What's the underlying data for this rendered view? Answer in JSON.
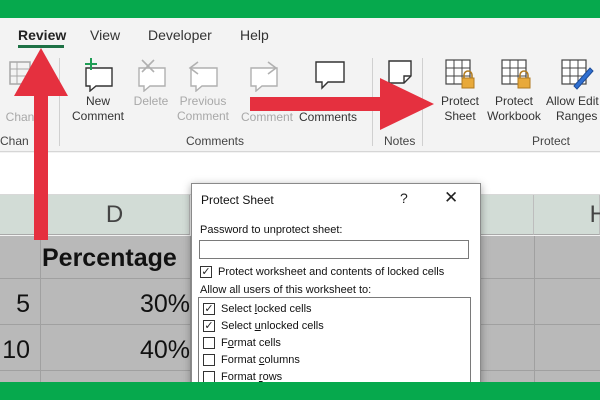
{
  "tabs": {
    "review": "Review",
    "view": "View",
    "developer": "Developer",
    "help": "Help"
  },
  "ribbon": {
    "changes_partial": "Chan",
    "changes_group_partial": "Chan",
    "new_comment": [
      "New",
      "Comment"
    ],
    "delete": "Delete",
    "previous_comment": [
      "Previous",
      "Comment"
    ],
    "next_comment_partial": "Comment",
    "show_comments": "Comments",
    "comments_group": "Comments",
    "notes_group": "Notes",
    "protect_sheet": [
      "Protect",
      "Sheet"
    ],
    "protect_workbook": [
      "Protect",
      "Workbook"
    ],
    "allow_edit_ranges": [
      "Allow Edit",
      "Ranges"
    ],
    "protect_group": "Protect"
  },
  "sheet": {
    "col_d": "D",
    "col_h_partial": "H",
    "header_cell": "Percentage",
    "rows": [
      {
        "c": "5",
        "d": "30%"
      },
      {
        "c": "10",
        "d": "40%"
      }
    ]
  },
  "dialog": {
    "title": "Protect Sheet",
    "help": "?",
    "close": "✕",
    "password_label": "Password to unprotect sheet:",
    "password_value": "",
    "protect_contents": "Protect worksheet and contents of locked cells",
    "allow_label": "Allow all users of this worksheet to:",
    "options": [
      {
        "pre": "Select ",
        "u": "l",
        "post": "ocked cells",
        "checked": true
      },
      {
        "pre": "Select ",
        "u": "u",
        "post": "nlocked cells",
        "checked": true
      },
      {
        "pre": "F",
        "u": "o",
        "post": "rmat cells",
        "checked": false
      },
      {
        "pre": "Format ",
        "u": "c",
        "post": "olumns",
        "checked": false
      },
      {
        "pre": "Format ",
        "u": "r",
        "post": "ows",
        "checked": false
      }
    ]
  },
  "colors": {
    "accent_green": "#06a94d",
    "arrow_red": "#e5303f",
    "lock_gold": "#e8a93a"
  }
}
